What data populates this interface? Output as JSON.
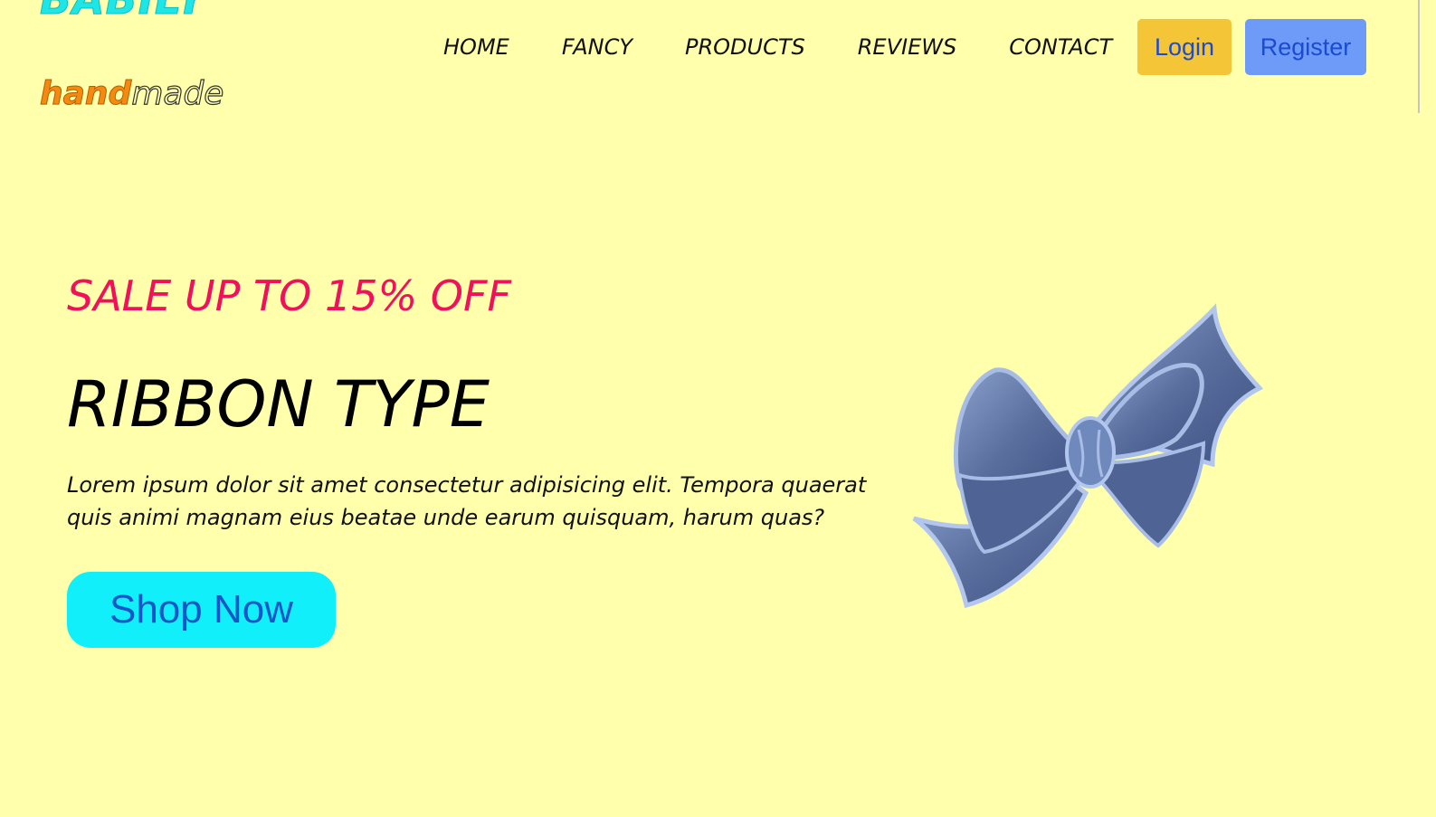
{
  "brand": {
    "logo": "BABILY",
    "tagline_part_a": "hand",
    "tagline_part_b": "made"
  },
  "nav": {
    "items": [
      "HOME",
      "FANCY",
      "PRODUCTS",
      "REVIEWS",
      "CONTACT"
    ]
  },
  "auth": {
    "login_label": "Login",
    "register_label": "Register"
  },
  "hero": {
    "sale_text": "SALE UP TO 15% OFF",
    "title": "RIBBON TYPE",
    "description": "Lorem ipsum dolor sit amet consectetur adipisicing elit. Tempora quaerat quis animi magnam eius beatae unde earum quisquam, harum quas?",
    "cta_label": "Shop Now",
    "image_icon": "ribbon-bow-image"
  },
  "colors": {
    "background": "#ffffac",
    "logo": "#1ee6e6",
    "sale": "#f0115a",
    "login_bg": "#f3c537",
    "register_bg": "#6e9af8",
    "cta_bg": "#11f0fa",
    "button_text": "#1a4bd1"
  }
}
